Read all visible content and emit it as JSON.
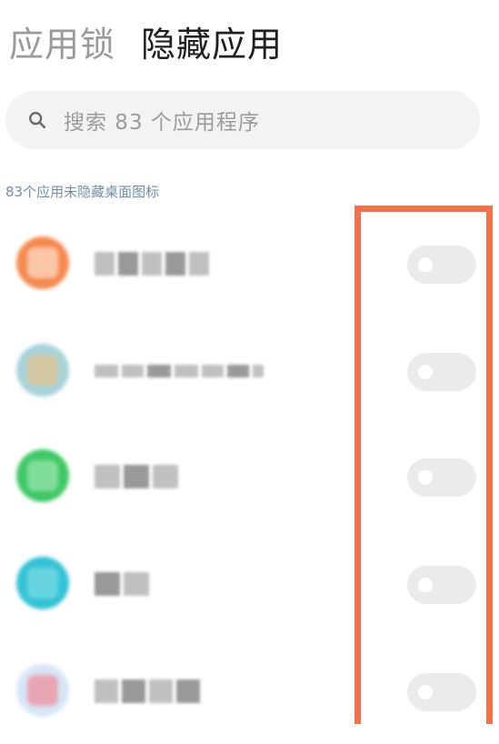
{
  "header": {
    "tab_app_lock": "应用锁",
    "tab_hide_apps": "隐藏应用",
    "active_tab": "隐藏应用"
  },
  "search": {
    "placeholder": "搜索 83 个应用程序",
    "icon": "search-icon"
  },
  "list_summary": "83个应用未隐藏桌面图标",
  "apps": [
    {
      "icon_color": "#f58a4e",
      "icon_inner": "#fde0cf",
      "hidden": false
    },
    {
      "icon_color": "#a7d3d9",
      "icon_inner": "#e7c48c",
      "hidden": false
    },
    {
      "icon_color": "#3fc866",
      "icon_inner": "#9ee6b0",
      "hidden": false
    },
    {
      "icon_color": "#33c3d6",
      "icon_inner": "#7fdbe6",
      "hidden": false
    },
    {
      "icon_color": "#d7e6f5",
      "icon_inner": "#f08a9a",
      "hidden": false
    }
  ],
  "colors": {
    "highlight": "#f4724a",
    "toggle_off": "#ebebeb"
  }
}
